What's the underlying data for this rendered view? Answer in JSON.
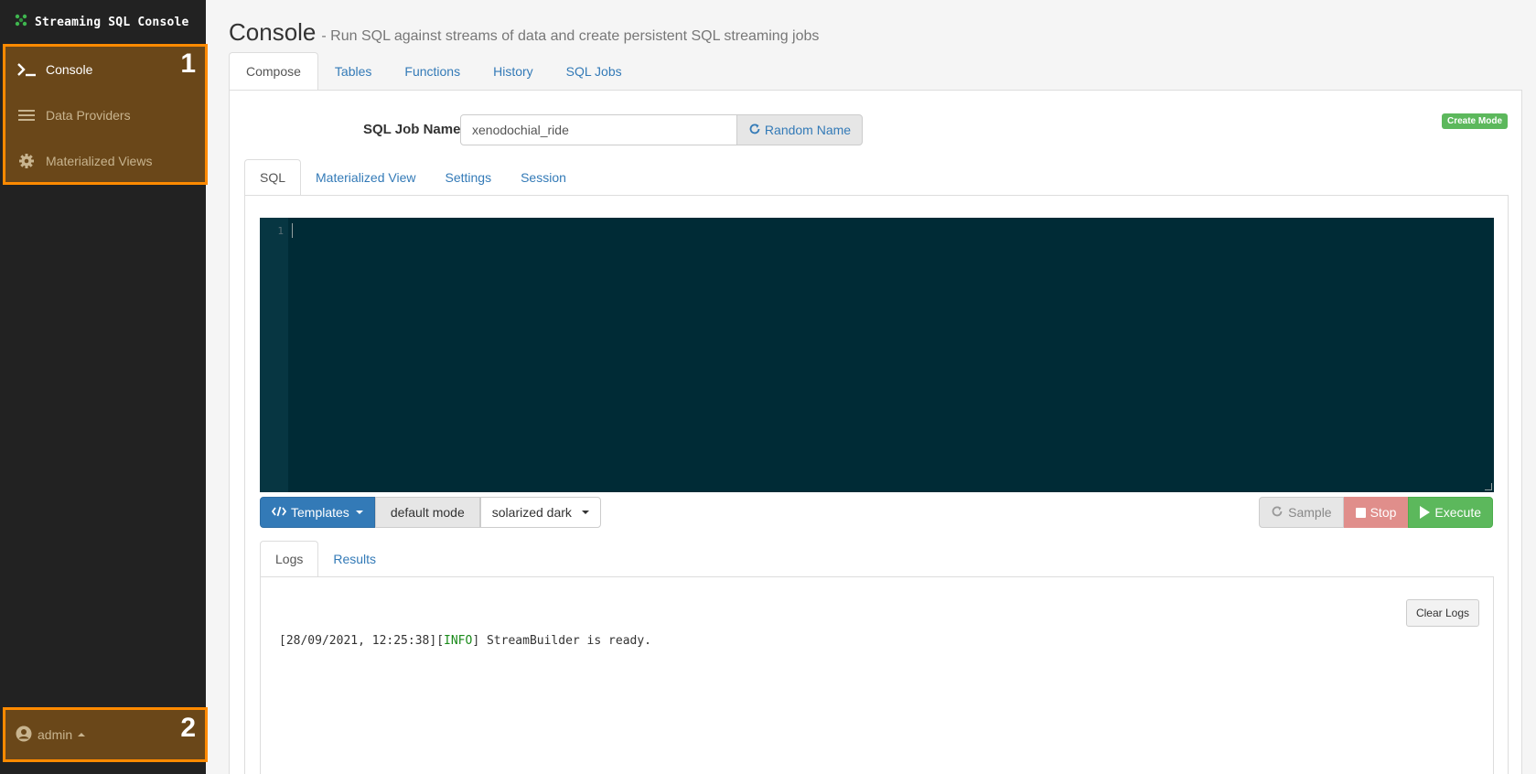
{
  "app": {
    "brand_title": "Streaming SQL Console"
  },
  "sidebar": {
    "items": [
      {
        "label": "Console",
        "icon": "terminal-icon"
      },
      {
        "label": "Data Providers",
        "icon": "list-icon"
      },
      {
        "label": "Materialized Views",
        "icon": "gear-icon"
      }
    ],
    "annotation_nav": "1",
    "user": {
      "label": "admin",
      "icon": "user-circle-icon"
    },
    "annotation_user": "2"
  },
  "header": {
    "title": "Console",
    "subtitle": "- Run SQL against streams of data and create persistent SQL streaming jobs"
  },
  "top_tabs": [
    "Compose",
    "Tables",
    "Functions",
    "History",
    "SQL Jobs"
  ],
  "job": {
    "label": "SQL Job Name",
    "value": "xenodochial_ride",
    "random_label": "Random Name",
    "mode_badge": "Create Mode"
  },
  "sql_tabs": [
    "SQL",
    "Materialized View",
    "Settings",
    "Session"
  ],
  "editor": {
    "line_number": "1"
  },
  "toolbar": {
    "templates_label": "Templates",
    "mode_label": "default mode",
    "theme_label": "solarized dark",
    "sample_label": "Sample",
    "stop_label": "Stop",
    "execute_label": "Execute"
  },
  "log_tabs": [
    "Logs",
    "Results"
  ],
  "logs": {
    "clear_label": "Clear Logs",
    "entries": [
      {
        "timestamp": "[28/09/2021, 12:25:38]",
        "level": "INFO",
        "message": "StreamBuilder is ready."
      }
    ]
  },
  "colors": {
    "sidebar_bg": "#222222",
    "highlight_border": "#ff8a00",
    "editor_bg": "#002b36",
    "primary": "#337ab7",
    "success": "#5cb85c",
    "danger": "#e08e8b"
  }
}
